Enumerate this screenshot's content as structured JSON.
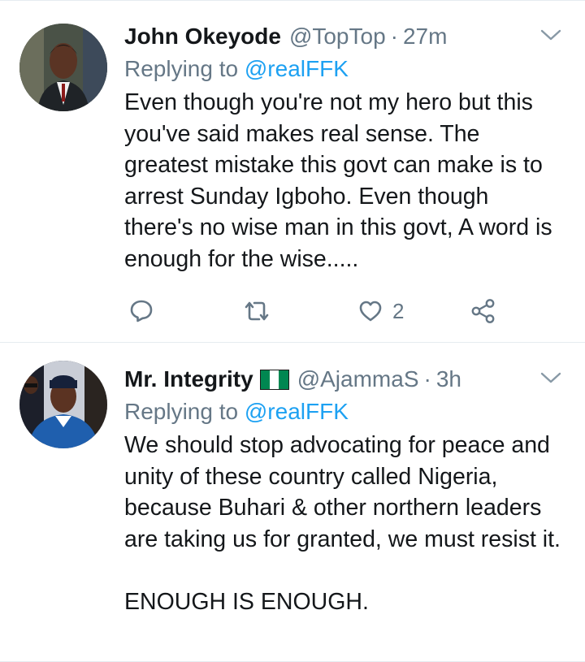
{
  "tweets": [
    {
      "display_name": "John Okeyode",
      "handle": "@TopTop",
      "separator": "·",
      "time": "27m",
      "replying_prefix": "Replying to",
      "replying_to": "@realFFK",
      "text": "Even though you're not my hero but this you've said makes real sense. The greatest mistake this govt can make is to arrest Sunday Igboho. Even though there's no wise man in this govt, A word is enough for the wise.....",
      "like_count": "2"
    },
    {
      "display_name": "Mr. Integrity",
      "flag_icon": "nigeria-flag-icon",
      "handle": "@AjammaS",
      "separator": "·",
      "time": "3h",
      "replying_prefix": "Replying to",
      "replying_to": "@realFFK",
      "text": "We should stop advocating for peace and unity of these country called Nigeria, because Buhari & other northern leaders are taking us for granted, we must resist it.\n\nENOUGH IS ENOUGH."
    }
  ],
  "colors": {
    "text": "#14171a",
    "secondary": "#657786",
    "link": "#1da1f2",
    "divider": "#e6ecf0",
    "flag_green": "#008751"
  }
}
